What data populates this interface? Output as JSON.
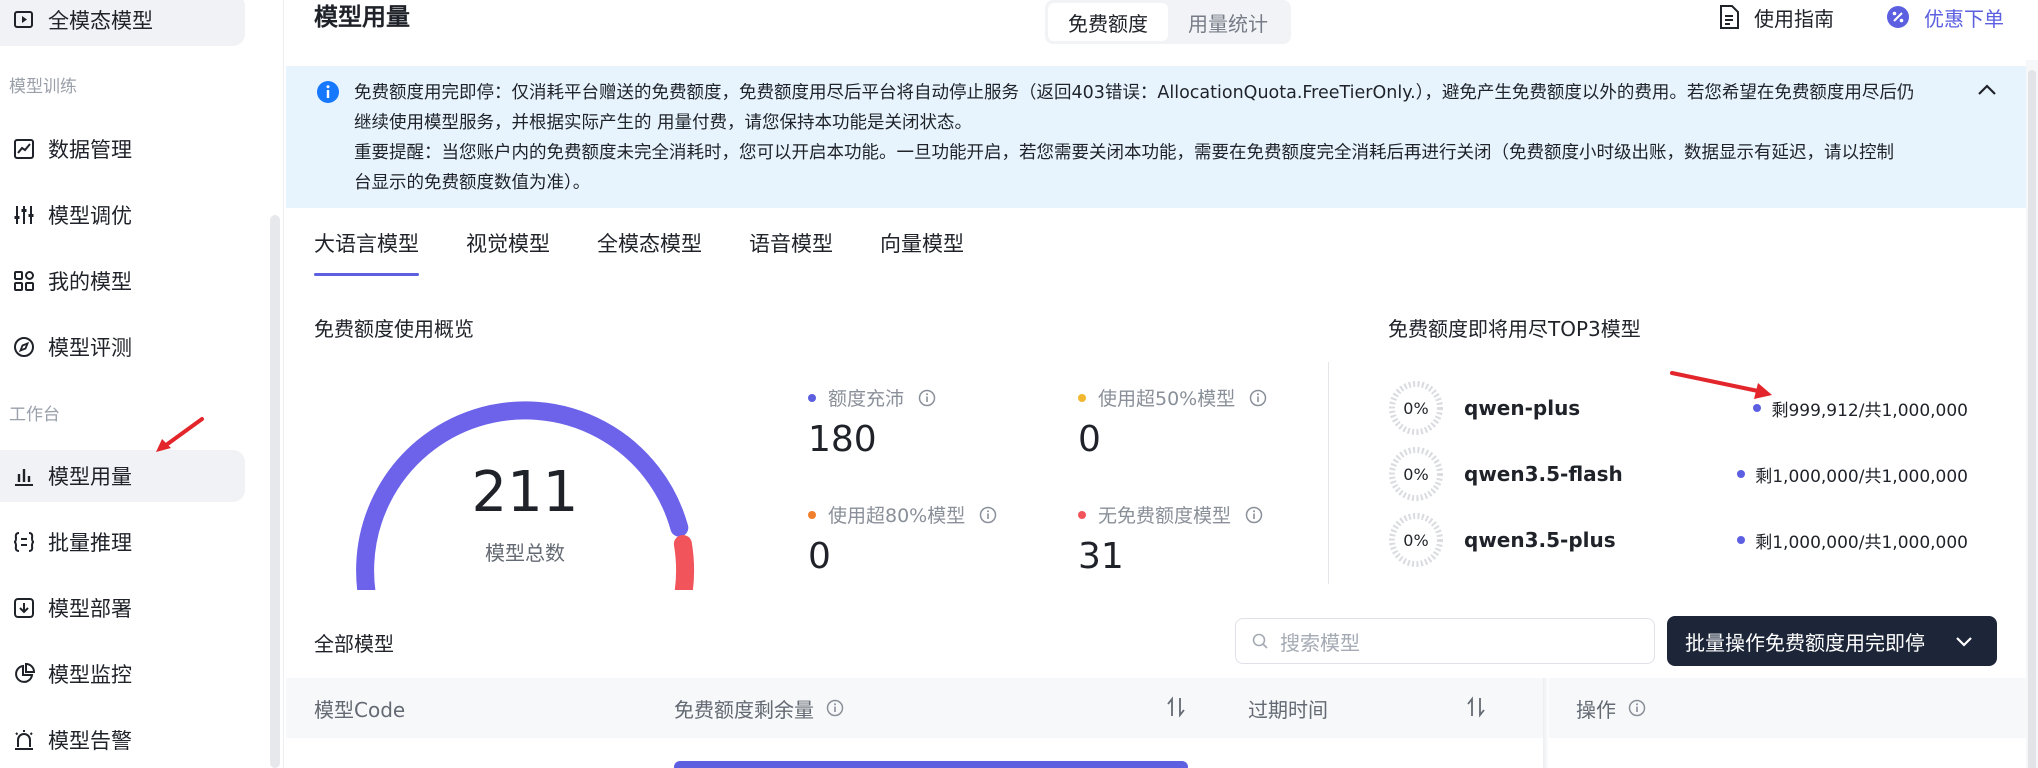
{
  "sidebar": {
    "top_item": "全模态模型",
    "section_training": "模型训练",
    "section_workbench": "工作台",
    "items": [
      {
        "label": "数据管理",
        "icon": "line-chart-icon"
      },
      {
        "label": "模型调优",
        "icon": "sliders-icon"
      },
      {
        "label": "我的模型",
        "icon": "apps-icon"
      },
      {
        "label": "模型评测",
        "icon": "compass-icon"
      },
      {
        "label": "模型用量",
        "icon": "bar-chart-icon",
        "active": true
      },
      {
        "label": "批量推理",
        "icon": "braces-list-icon"
      },
      {
        "label": "模型部署",
        "icon": "deploy-icon"
      },
      {
        "label": "模型监控",
        "icon": "pie-chart-icon"
      },
      {
        "label": "模型告警",
        "icon": "alarm-icon"
      }
    ]
  },
  "header": {
    "title": "模型用量",
    "tabs": [
      "免费额度",
      "用量统计"
    ],
    "active_tab": "免费额度",
    "guide_label": "使用指南",
    "discount_label": "优惠下单"
  },
  "banner": {
    "line1": "免费额度用完即停：仅消耗平台赠送的免费额度，免费额度用尽后平台将自动停止服务（返回403错误：AllocationQuota.FreeTierOnly.），避免产生免费额度以外的费用。若您希望在免费额度用尽后仍",
    "line2": "继续使用模型服务，并根据实际产生的 用量付费，请您保持本功能是关闭状态。",
    "line3": "重要提醒：当您账户内的免费额度未完全消耗时，您可以开启本功能。一旦功能开启，若您需要关闭本功能，需要在免费额度完全消耗后再进行关闭（免费额度小时级出账，数据显示有延迟，请以控制",
    "line4": "台显示的免费额度数值为准）。"
  },
  "model_tabs": [
    "大语言模型",
    "视觉模型",
    "全模态模型",
    "语音模型",
    "向量模型"
  ],
  "overview": {
    "title": "免费额度使用概览",
    "total": "211",
    "total_label": "模型总数",
    "gauge_fraction": 0.853,
    "stats": [
      {
        "label": "额度充沛",
        "value": "180",
        "color": "#5b5fe0"
      },
      {
        "label": "使用超50%模型",
        "value": "0",
        "color": "#f0b72f"
      },
      {
        "label": "使用超80%模型",
        "value": "0",
        "color": "#f07f2d"
      },
      {
        "label": "无免费额度模型",
        "value": "31",
        "color": "#f2545b"
      }
    ]
  },
  "top3": {
    "title": "免费额度即将用尽TOP3模型",
    "items": [
      {
        "pct": "0%",
        "name": "qwen-plus",
        "remain": "剩999,912/共1,000,000"
      },
      {
        "pct": "0%",
        "name": "qwen3.5-flash",
        "remain": "剩1,000,000/共1,000,000"
      },
      {
        "pct": "0%",
        "name": "qwen3.5-plus",
        "remain": "剩1,000,000/共1,000,000"
      }
    ]
  },
  "models": {
    "title": "全部模型",
    "search_placeholder": "搜索模型",
    "bulk_button": "批量操作免费额度用完即停",
    "columns": [
      "模型Code",
      "免费额度剩余量",
      "过期时间",
      "操作"
    ]
  },
  "colors": {
    "accent": "#5b5fe0",
    "danger": "#f2545b",
    "banner_bg": "#e8f4fd",
    "dark_button": "#1d2638"
  }
}
